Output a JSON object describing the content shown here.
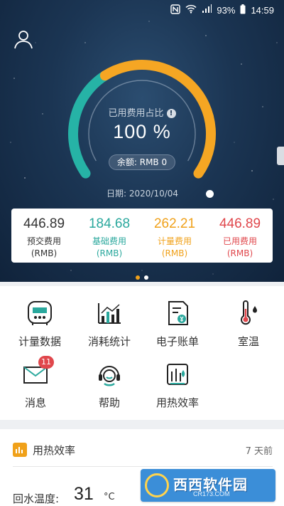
{
  "status_bar": {
    "battery": "93%",
    "time": "14:59"
  },
  "gauge": {
    "ratio_label": "已用费用占比",
    "percent": "100 %",
    "balance": "余额: RMB 0",
    "date": "日期: 2020/10/04",
    "fill_fraction": 1.0,
    "colors": {
      "used": "#f5a623",
      "base": "#26b3a6"
    }
  },
  "fees": [
    {
      "amount": "446.89",
      "label": "预交费用",
      "unit": "(RMB)",
      "color": "#333333"
    },
    {
      "amount": "184.68",
      "label": "基础费用",
      "unit": "(RMB)",
      "color": "#2aa89d"
    },
    {
      "amount": "262.21",
      "label": "计量费用",
      "unit": "(RMB)",
      "color": "#f0a11a"
    },
    {
      "amount": "446.89",
      "label": "已用费用",
      "unit": "(RMB)",
      "color": "#e0474c"
    }
  ],
  "pager": {
    "pages": 2,
    "active": 0
  },
  "menu": [
    {
      "label": "计量数据",
      "icon": "meter-icon"
    },
    {
      "label": "消耗统计",
      "icon": "bar-chart-icon"
    },
    {
      "label": "电子账单",
      "icon": "bill-icon"
    },
    {
      "label": "室温",
      "icon": "thermometer-icon"
    },
    {
      "label": "消息",
      "icon": "mail-icon",
      "badge": "11"
    },
    {
      "label": "帮助",
      "icon": "headset-icon"
    },
    {
      "label": "用热效率",
      "icon": "heat-efficiency-icon"
    }
  ],
  "card": {
    "title": "用热效率",
    "time": "7 天前",
    "return_temp_label": "回水温度:",
    "return_temp_value": "31",
    "return_temp_unit": "°C"
  },
  "watermark": {
    "title": "西西软件园",
    "sub": "CR173.COM"
  }
}
